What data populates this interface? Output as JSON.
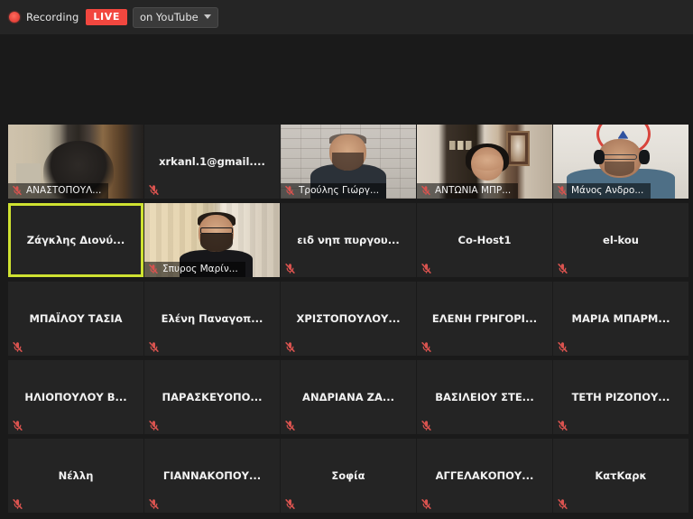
{
  "topbar": {
    "recording_label": "Recording",
    "live_badge": "LIVE",
    "platform_label": "on YouTube",
    "record_dot_icon": "record-dot-icon",
    "caret_icon": "chevron-down-icon",
    "live_color": "#f2473f",
    "bar_bg_color": "#252525"
  },
  "gallery": {
    "columns": 5,
    "active_border_color": "#cfe231",
    "tile_bg_color": "#242424",
    "mute_icon_color": "#d9534f",
    "mute_icon_name": "microphone-muted-icon",
    "tiles": [
      {
        "name": "ΑΝΑΣΤΟΠΟΥΛ...",
        "label_position": "corner",
        "has_video": true,
        "muted": true,
        "active": false
      },
      {
        "name": "xrkanl.1@gmail....",
        "label_position": "center",
        "has_video": false,
        "muted": true,
        "active": false
      },
      {
        "name": "Τρούλης Γιώργ...",
        "label_position": "corner",
        "has_video": true,
        "muted": true,
        "active": false
      },
      {
        "name": "ΑΝΤΩΝΙΑ ΜΠΡ...",
        "label_position": "corner",
        "has_video": true,
        "muted": true,
        "active": false
      },
      {
        "name": "Μάνος Ανδρο...",
        "label_position": "corner",
        "has_video": true,
        "muted": true,
        "active": false
      },
      {
        "name": "Ζάγκλης Διονύ...",
        "label_position": "center",
        "has_video": false,
        "muted": false,
        "active": true
      },
      {
        "name": "Σπυρος Μαρίν...",
        "label_position": "corner",
        "has_video": true,
        "muted": true,
        "active": false
      },
      {
        "name": "ειδ νηπ πυργου...",
        "label_position": "center",
        "has_video": false,
        "muted": true,
        "active": false
      },
      {
        "name": "Co-Host1",
        "label_position": "center",
        "has_video": false,
        "muted": true,
        "active": false
      },
      {
        "name": "el-kou",
        "label_position": "center",
        "has_video": false,
        "muted": true,
        "active": false
      },
      {
        "name": "ΜΠΑΪΛΟΥ ΤΑΣΙΑ",
        "label_position": "center",
        "has_video": false,
        "muted": true,
        "active": false
      },
      {
        "name": "Ελένη Παναγοπ...",
        "label_position": "center",
        "has_video": false,
        "muted": true,
        "active": false
      },
      {
        "name": "ΧΡΙΣΤΟΠΟΥΛΟΥ...",
        "label_position": "center",
        "has_video": false,
        "muted": true,
        "active": false
      },
      {
        "name": "ΕΛΕΝΗ ΓΡΗΓΟΡΙ...",
        "label_position": "center",
        "has_video": false,
        "muted": true,
        "active": false
      },
      {
        "name": "ΜΑΡΙΑ ΜΠΑΡΜ...",
        "label_position": "center",
        "has_video": false,
        "muted": true,
        "active": false
      },
      {
        "name": "ΗΛΙΟΠΟΥΛΟΥ Β...",
        "label_position": "center",
        "has_video": false,
        "muted": true,
        "active": false
      },
      {
        "name": "ΠΑΡΑΣΚΕΥΟΠΟ...",
        "label_position": "center",
        "has_video": false,
        "muted": true,
        "active": false
      },
      {
        "name": "ΑΝΔΡΙΑΝΑ ΖΑ...",
        "label_position": "center",
        "has_video": false,
        "muted": true,
        "active": false
      },
      {
        "name": "ΒΑΣΙΛΕΙΟΥ ΣΤΕ...",
        "label_position": "center",
        "has_video": false,
        "muted": true,
        "active": false
      },
      {
        "name": "ΤΕΤΗ ΡΙΖΟΠΟΥ...",
        "label_position": "center",
        "has_video": false,
        "muted": true,
        "active": false
      },
      {
        "name": "Νέλλη",
        "label_position": "center",
        "has_video": false,
        "muted": true,
        "active": false
      },
      {
        "name": "ΓΙΑΝΝΑΚΟΠΟΥ...",
        "label_position": "center",
        "has_video": false,
        "muted": true,
        "active": false
      },
      {
        "name": "Σοφία",
        "label_position": "center",
        "has_video": false,
        "muted": true,
        "active": false
      },
      {
        "name": "ΑΓΓΕΛΑΚΟΠΟΥ...",
        "label_position": "center",
        "has_video": false,
        "muted": true,
        "active": false
      },
      {
        "name": "ΚατΚαρκ",
        "label_position": "center",
        "has_video": false,
        "muted": true,
        "active": false
      }
    ]
  }
}
